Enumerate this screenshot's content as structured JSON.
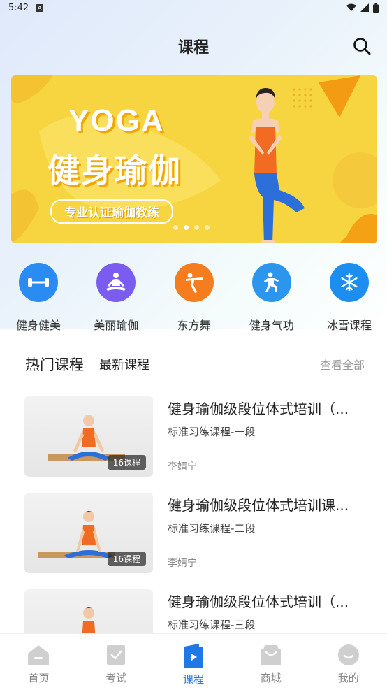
{
  "status": {
    "time": "5:42",
    "notif_glyph": "A"
  },
  "header": {
    "title": "课程"
  },
  "banner": {
    "heading_en": "YOGA",
    "heading_cn": "健身瑜伽",
    "tagline": "专业认证瑜伽教练",
    "slide_count": 4,
    "active_slide": 2
  },
  "categories": [
    {
      "label": "健身健美",
      "icon": "dumbbell-icon",
      "color": "#2a8bf2"
    },
    {
      "label": "美丽瑜伽",
      "icon": "meditation-icon",
      "color": "#7a5cf0"
    },
    {
      "label": "东方舞",
      "icon": "dancer-icon",
      "color": "#f57c1f"
    },
    {
      "label": "健身气功",
      "icon": "tai-chi-icon",
      "color": "#2c95ee"
    },
    {
      "label": "冰雪课程",
      "icon": "snowflake-icon",
      "color": "#1c8ef0"
    }
  ],
  "course_tabs": {
    "hot": "热门课程",
    "latest": "最新课程",
    "view_all": "查看全部"
  },
  "courses": [
    {
      "title": "健身瑜伽级段位体式培训（...",
      "level": "标准习练课程-一段",
      "teacher": "李婧宁",
      "count": "16课程"
    },
    {
      "title": "健身瑜伽级段位体式培训课...",
      "level": "标准习练课程-二段",
      "teacher": "李婧宁",
      "count": "16课程"
    },
    {
      "title": "健身瑜伽级段位体式培训（...",
      "level": "标准习练课程-三段",
      "teacher": "",
      "count": ""
    }
  ],
  "tabbar": {
    "home": "首页",
    "exam": "考试",
    "course": "课程",
    "mall": "商城",
    "mine": "我的"
  },
  "colors": {
    "accent": "#1e78e6",
    "banner_bg": "#f7d540"
  }
}
